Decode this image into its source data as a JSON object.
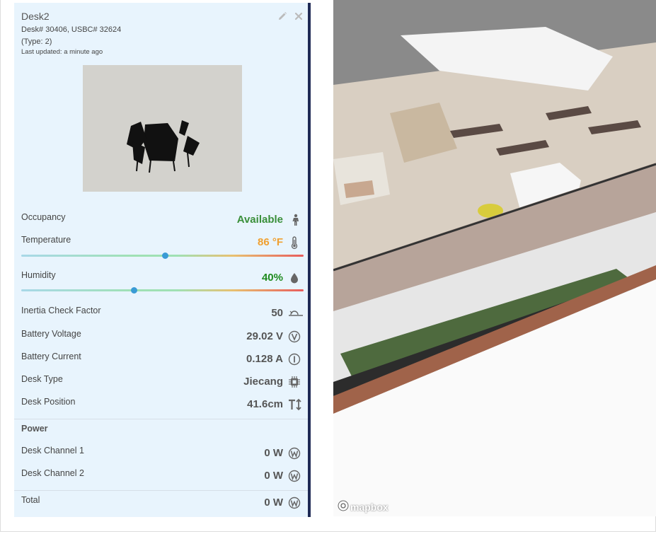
{
  "panel": {
    "title": "Desk2",
    "ids": "Desk# 30406, USBC# 32624",
    "type_line": "(Type: 2)",
    "last_updated": "Last updated: a minute ago"
  },
  "metrics": {
    "occupancy": {
      "label": "Occupancy",
      "value": "Available",
      "color": "#3a8f3a"
    },
    "temperature": {
      "label": "Temperature",
      "value": "86 °F",
      "color": "#f0a030",
      "level": 0.51
    },
    "humidity": {
      "label": "Humidity",
      "value": "40%",
      "color": "#1e8a1e",
      "level": 0.4
    },
    "inertia": {
      "label": "Inertia Check Factor",
      "value": "50"
    },
    "battery_voltage": {
      "label": "Battery Voltage",
      "value": "29.02 V"
    },
    "battery_current": {
      "label": "Battery Current",
      "value": "0.128 A"
    },
    "desk_type": {
      "label": "Desk Type",
      "value": "Jiecang"
    },
    "desk_position": {
      "label": "Desk Position",
      "value": "41.6cm"
    }
  },
  "power": {
    "section_title": "Power",
    "channel1": {
      "label": "Desk Channel 1",
      "value": "0 W"
    },
    "channel2": {
      "label": "Desk Channel 2",
      "value": "0 W"
    },
    "total": {
      "label": "Total",
      "value": "0 W"
    }
  },
  "map": {
    "attribution": "mapbox"
  },
  "icons": {
    "edit": "pencil-icon",
    "close": "close-icon",
    "occupancy": "person-icon",
    "temperature": "thermometer-icon",
    "humidity": "droplet-icon",
    "inertia": "inertia-icon",
    "voltage": "voltage-icon",
    "current": "current-icon",
    "desk_type": "chip-icon",
    "desk_position": "height-icon",
    "watt": "watt-icon"
  }
}
